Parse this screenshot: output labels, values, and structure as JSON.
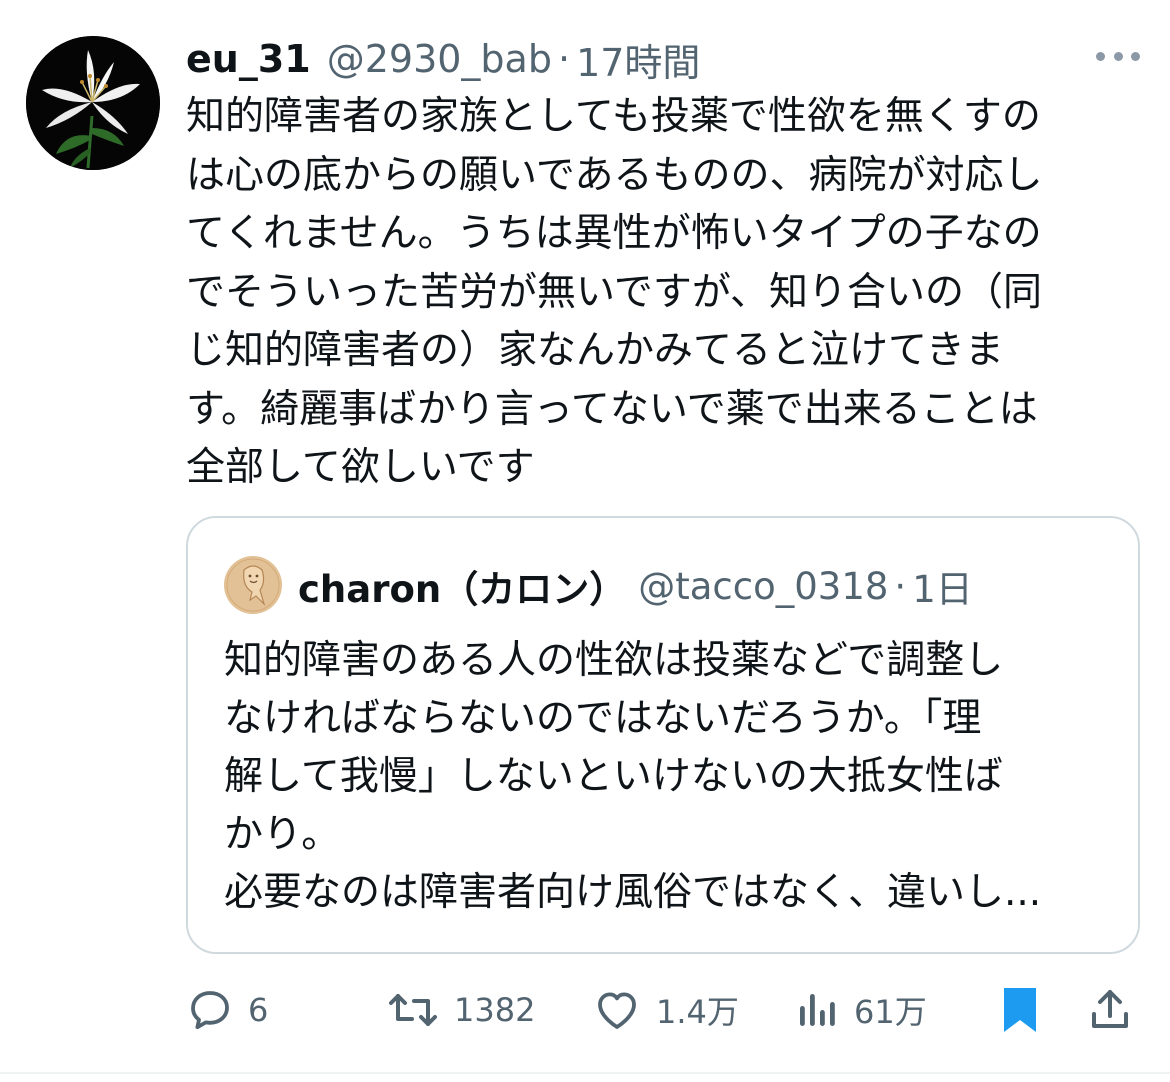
{
  "tweet": {
    "display_name": "eu_31",
    "handle": "@2930_bab",
    "separator": "·",
    "time": "17時間",
    "body": "知的障害者の家族としても投薬で性欲を無くすの\nは心の底からの願いであるものの、病院が対応し\nてくれません。うちは異性が怖いタイプの子なの\nでそういった苦労が無いですが、知り合いの（同\nじ知的障害者の）家なんかみてると泣けてきま\nす。綺麗事ばかり言ってないで薬で出来ることは\n全部して欲しいです"
  },
  "quote": {
    "display_name": "charon（カロン）",
    "handle": "@tacco_0318",
    "separator": "·",
    "time": "1日",
    "body": "知的障害のある人の性欲は投薬などで調整し\nなければならないのではないだろうか。「理\n解して我慢」しないといけないの大抵女性ば\nかり。\n必要なのは障害者向け風俗ではなく、違いし..."
  },
  "actions": {
    "reply_count": "6",
    "retweet_count": "1382",
    "like_count": "1.4万",
    "view_count": "61万"
  },
  "icons": {
    "more": "more-icon",
    "reply": "reply-icon",
    "retweet": "retweet-icon",
    "like": "like-icon",
    "views": "views-icon",
    "bookmark": "bookmark-icon",
    "share": "share-icon"
  },
  "colors": {
    "text": "#0f1419",
    "secondary": "#536471",
    "border": "#cfd9de",
    "bookmark_active": "#1d9bf0"
  }
}
